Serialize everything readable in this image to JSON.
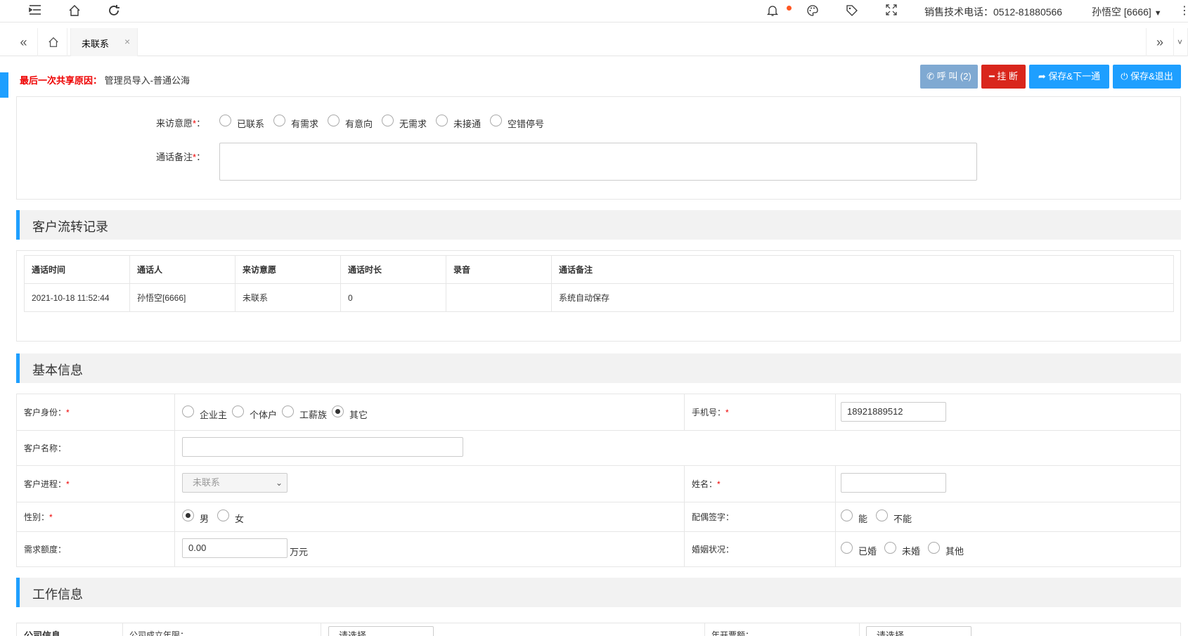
{
  "topbar": {
    "menu_icon": "menu-fold-icon",
    "home_icon": "home-icon",
    "refresh_icon": "refresh-icon",
    "bell_icon": "bell-icon",
    "theme_icon": "palette-icon",
    "tag_icon": "tag-icon",
    "fullscreen_icon": "fullscreen-icon",
    "phone_text": "销售技术电话：0512-81880566",
    "user_text": "孙悟空 [6666]",
    "more_icon": "more-vertical-icon"
  },
  "tabs": {
    "active_label": "未联系",
    "close": "×"
  },
  "reason": {
    "label": "最后一次共享原因：",
    "value": "管理员导入-普通公海"
  },
  "buttons": {
    "call": "呼 叫 (2)",
    "hangup": "挂 断",
    "save_next": "保存&下一通",
    "save_exit": "保存&退出"
  },
  "visit_form": {
    "intent_label": "来访意愿",
    "intent_options": [
      "已联系",
      "有需求",
      "有意向",
      "无需求",
      "未接通",
      "空错停号"
    ],
    "note_label": "通话备注",
    "note_value": ""
  },
  "section_titles": {
    "transfer": "客户流转记录",
    "basic": "基本信息",
    "work": "工作信息"
  },
  "records": {
    "headers": [
      "通话时间",
      "通话人",
      "来访意愿",
      "通话时长",
      "录音",
      "通话备注"
    ],
    "rows": [
      [
        "2021-10-18 11:52:44",
        "孙悟空[6666]",
        "未联系",
        "0",
        "",
        "系统自动保存"
      ]
    ]
  },
  "basic": {
    "identity_label": "客户身份：",
    "identity_options": [
      "企业主",
      "个体户",
      "工薪族",
      "其它"
    ],
    "identity_selected": "其它",
    "phone_label": "手机号：",
    "phone_value": "18921889512",
    "name_label": "客户名称：",
    "name_value": "",
    "progress_label": "客户进程：",
    "progress_value": "未联系",
    "person_label": "姓名：",
    "person_value": "",
    "gender_label": "性别：",
    "gender_options": [
      "男",
      "女"
    ],
    "gender_selected": "男",
    "spouse_label": "配偶签字：",
    "spouse_options": [
      "能",
      "不能"
    ],
    "amount_label": "需求额度：",
    "amount_value": "0.00",
    "amount_unit": "万元",
    "marital_label": "婚姻状况：",
    "marital_options": [
      "已婚",
      "未婚",
      "其他"
    ]
  },
  "work": {
    "company_label": "公司信息",
    "established_label": "公司成立年限：",
    "established_value": "请选择",
    "revenue_label": "年开票额：",
    "revenue_value": "请选择"
  },
  "colors": {
    "primary": "#1e9fff",
    "danger": "#d9261c",
    "call_btn": "#7fa9d2",
    "required": "#ee0000"
  }
}
